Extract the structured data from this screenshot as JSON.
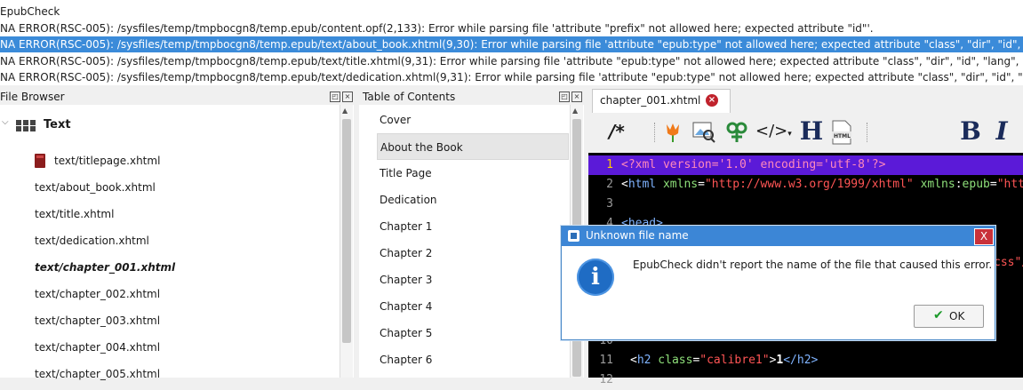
{
  "epubcheck": {
    "title": "EpubCheck",
    "errors": [
      "NA ERROR(RSC-005): /sysfiles/temp/tmpbocgn8/temp.epub/content.opf(2,133): Error while parsing file 'attribute \"prefix\" not allowed here; expected attribute \"id\"'.",
      "NA ERROR(RSC-005): /sysfiles/temp/tmpbocgn8/temp.epub/text/about_book.xhtml(9,30): Error while parsing file 'attribute \"epub:type\" not allowed here; expected attribute \"class\", \"dir\", \"id\", \"la",
      "NA ERROR(RSC-005): /sysfiles/temp/tmpbocgn8/temp.epub/text/title.xhtml(9,31): Error while parsing file 'attribute \"epub:type\" not allowed here; expected attribute \"class\", \"dir\", \"id\", \"lang\", \"st",
      "NA ERROR(RSC-005): /sysfiles/temp/tmpbocgn8/temp.epub/text/dedication.xhtml(9,31): Error while parsing file 'attribute \"epub:type\" not allowed here; expected attribute \"class\", \"dir\", \"id\", \"lar"
    ]
  },
  "file_browser": {
    "title": "File Browser",
    "folder": "Text",
    "files": [
      "text/titlepage.xhtml",
      "text/about_book.xhtml",
      "text/title.xhtml",
      "text/dedication.xhtml",
      "text/chapter_001.xhtml",
      "text/chapter_002.xhtml",
      "text/chapter_003.xhtml",
      "text/chapter_004.xhtml",
      "text/chapter_005.xhtml"
    ]
  },
  "toc": {
    "title": "Table of Contents",
    "items": [
      "Cover",
      "About the Book",
      "Title Page",
      "Dedication",
      "Chapter 1",
      "Chapter 2",
      "Chapter 3",
      "Chapter 4",
      "Chapter 5",
      "Chapter 6"
    ]
  },
  "editor": {
    "tab_label": "chapter_001.xhtml",
    "toolbar": {
      "comment": "/*",
      "heading": "H",
      "bold": "B",
      "italic": "I",
      "code": "</>"
    },
    "lines": [
      {
        "num": "1",
        "pi": "<?xml version='1.0' encoding='utf-8'?>"
      },
      {
        "num": "2",
        "tag_open": "<",
        "tag_name": "html",
        "attr1": " xmlns",
        "eq1": "=",
        "val1": "\"http://www.w3.org/1999/xhtml\"",
        "attr2": " xmlns",
        "colon": ":",
        "attr3": "epub",
        "eq2": "=",
        "val2": "\"htt"
      },
      {
        "num": "3"
      },
      {
        "num": "4",
        "tag": "<head>"
      },
      {
        "num": "10"
      },
      {
        "num": "11",
        "t1": "<",
        "t2": "h2",
        "a1": " class",
        "e1": "=",
        "v1": "\"calibre1\"",
        "t3": ">",
        "x1": "1",
        "t4": "</h2>"
      }
    ],
    "partial_visible": "css\"/",
    "partial_num": "12"
  },
  "dialog": {
    "title": "Unknown file name",
    "message": "EpubCheck didn't report the name of the file that caused this error.",
    "ok_label": "OK",
    "close_glyph": "X",
    "info_glyph": "i"
  },
  "colors": {
    "selection": "#3b8bd9",
    "dialog_title": "#3c86d6",
    "code_current_line": "#5b1ad8"
  }
}
